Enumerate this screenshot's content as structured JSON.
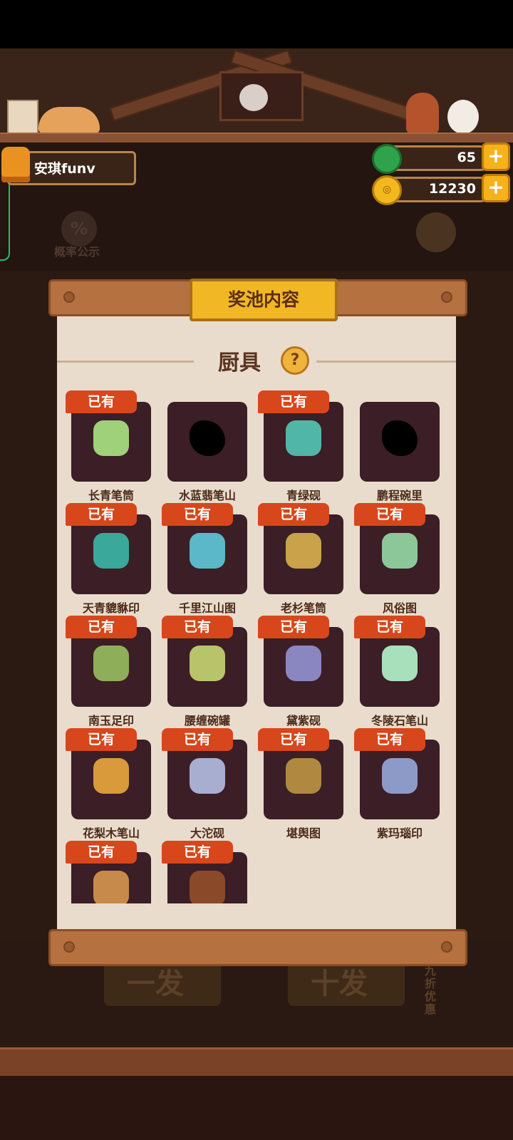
{
  "header": {
    "player_name": "安琪funv",
    "gems": "65",
    "coins": "12230",
    "plus_label": "+"
  },
  "background": {
    "probability_label": "概率公示",
    "probability_icon_text": "%",
    "single_draw": "一发",
    "ten_draw": "十发",
    "discount": "九折优惠"
  },
  "panel": {
    "title": "奖池内容",
    "category": "厨具",
    "help_label": "?",
    "owned_label": "已有"
  },
  "items": [
    {
      "name": "长青笔筒",
      "owned": true,
      "color": "#9fd07a"
    },
    {
      "name": "水蓝翡笔山",
      "owned": false,
      "color": "#000000"
    },
    {
      "name": "青绿砚",
      "owned": true,
      "color": "#4fb6a8"
    },
    {
      "name": "鹏程碗里",
      "owned": false,
      "color": "#000000"
    },
    {
      "name": "天青貔貅印",
      "owned": true,
      "color": "#3aa89a"
    },
    {
      "name": "千里江山图",
      "owned": true,
      "color": "#5ab8c8"
    },
    {
      "name": "老杉笔筒",
      "owned": true,
      "color": "#c9a24a"
    },
    {
      "name": "风俗图",
      "owned": true,
      "color": "#8cc79a"
    },
    {
      "name": "南玉足印",
      "owned": true,
      "color": "#8fae5a"
    },
    {
      "name": "腰缠碗罐",
      "owned": true,
      "color": "#b8c46a"
    },
    {
      "name": "黛紫砚",
      "owned": true,
      "color": "#8a86c0"
    },
    {
      "name": "冬陵石笔山",
      "owned": true,
      "color": "#a8e0bc"
    },
    {
      "name": "花梨木笔山",
      "owned": true,
      "color": "#d89a3a"
    },
    {
      "name": "大沱砚",
      "owned": true,
      "color": "#a8aed0"
    },
    {
      "name": "堪舆图",
      "owned": true,
      "color": "#b08840"
    },
    {
      "name": "紫玛瑙印",
      "owned": true,
      "color": "#8c9ac8"
    },
    {
      "name": "",
      "owned": true,
      "color": "#c88a4a"
    },
    {
      "name": "",
      "owned": true,
      "color": "#8a4a2a"
    }
  ]
}
